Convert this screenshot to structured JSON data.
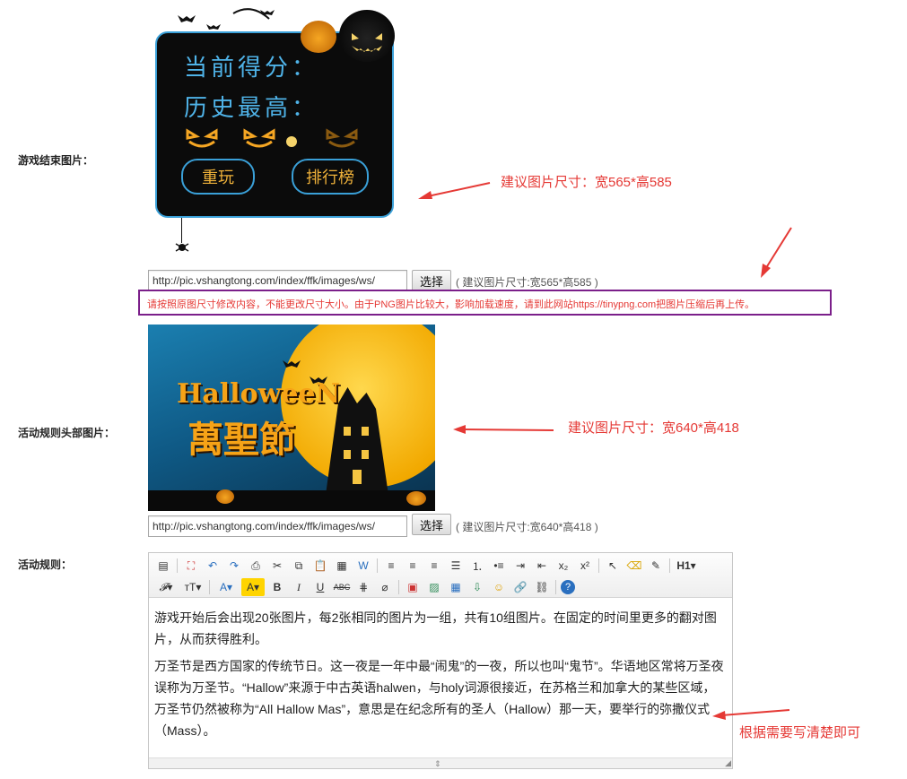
{
  "rows": {
    "game_end": {
      "label": "游戏结束图片：",
      "note": "建议图片尺寸：宽565*高585",
      "url_value": "http://pic.vshangtong.com/index/ffk/images/ws/",
      "pick_label": "选择",
      "size_hint": "( 建议图片尺寸:宽565*高585 )",
      "image": {
        "score_label": "当前得分：",
        "best_label": "历史最高：",
        "replay_label": "重玩",
        "rank_label": "排行榜"
      }
    },
    "warning": "请按照原图尺寸修改内容，不能更改尺寸大小。由于PNG图片比较大，影响加载速度，请到此网站https://tinypng.com把图片压缩后再上传。",
    "rules_header": {
      "label": "活动规则头部图片：",
      "note": "建议图片尺寸：宽640*高418",
      "url_value": "http://pic.vshangtong.com/index/ffk/images/ws/",
      "pick_label": "选择",
      "size_hint": "( 建议图片尺寸:宽640*高418 )",
      "image": {
        "title_en": "HalloweeN",
        "title_cn": "萬聖節"
      }
    },
    "rules": {
      "label": "活动规则：",
      "note": "根据需要写清楚即可",
      "toolbar": {
        "heading_label": "H1"
      },
      "paragraphs": [
        "游戏开始后会出现20张图片，每2张相同的图片为一组，共有10组图片。在固定的时间里更多的翻对图片，从而获得胜利。",
        "万圣节是西方国家的传统节日。这一夜是一年中最“闹鬼”的一夜，所以也叫“鬼节”。华语地区常将万圣夜误称为万圣节。“Hallow”来源于中古英语halwen，与holy词源很接近，在苏格兰和加拿大的某些区域，万圣节仍然被称为“All Hallow Mas”，意思是在纪念所有的圣人（Hallow）那一天，要举行的弥撒仪式（Mass）。"
      ]
    }
  },
  "colors": {
    "note_red": "#e53935",
    "warn_border": "#7b1f8a",
    "game_accent": "#3aa0d8",
    "pumpkin_orange": "#f5a623"
  }
}
